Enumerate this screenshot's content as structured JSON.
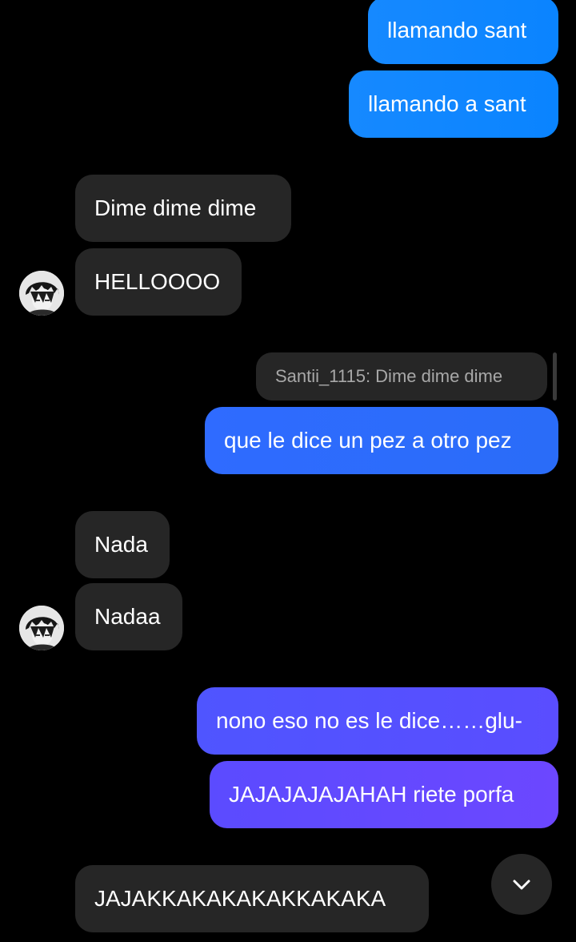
{
  "messages": {
    "m1": "llamando sant",
    "m2": "llamando a sant",
    "m3": "Dime dime dime",
    "m4": "HELLOOOO",
    "reply_quote": "Santii_1115: Dime dime dime",
    "m5": "que le dice un pez a otro pez",
    "m6": "Nada",
    "m7": "Nadaa",
    "m8": "nono eso no es le dice……glu-",
    "m9": "JAJAJAJAJAHAH riete porfa",
    "m10": "JAJAKKAKAKAKAKKAKAKA"
  },
  "icons": {
    "avatar": "contact-avatar",
    "scroll": "chevron-down-icon"
  },
  "colors": {
    "background": "#000000",
    "incoming_bubble": "#262626",
    "outgoing_blue": "#0a84ff",
    "outgoing_violet": "#6a4aff"
  }
}
